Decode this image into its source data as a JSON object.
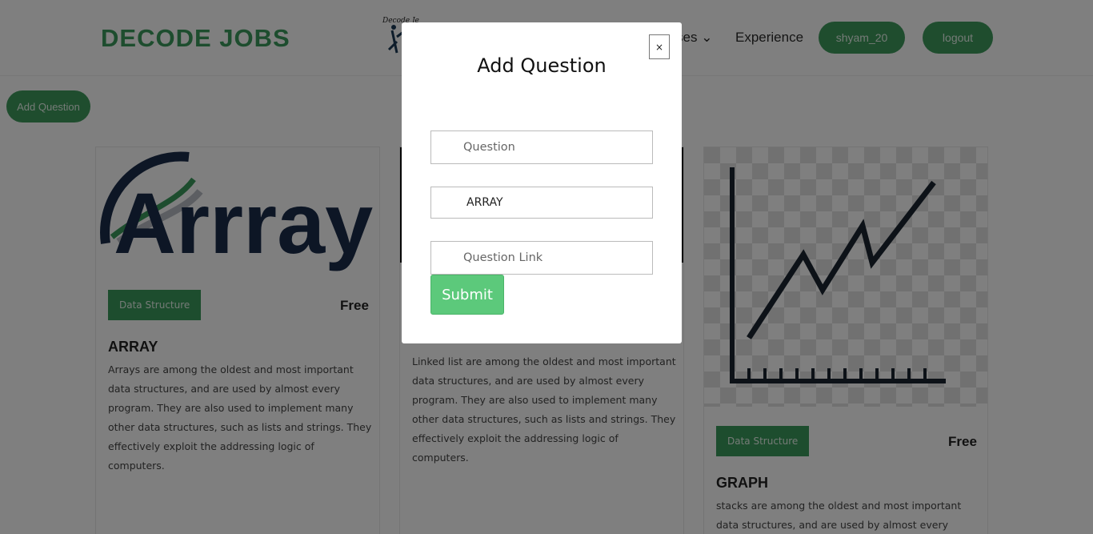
{
  "header": {
    "brand": "DECODE JOBS",
    "nav_courses": "ses",
    "nav_experience": "Experience",
    "username": "shyam_20",
    "logout": "logout"
  },
  "toolbar": {
    "add_question": "Add Question"
  },
  "cards": [
    {
      "image_text": "Arrray",
      "tag": "Data Structure",
      "price": "Free",
      "title": "ARRAY",
      "description": "Arrays are among the oldest and most important data structures, and are used by almost every program. They are also used to implement many other data structures, such as lists and strings. They effectively exploit the addressing logic of computers."
    },
    {
      "tag": "",
      "price": "",
      "title": "",
      "description": "Linked list are among the oldest and most important data structures, and are used by almost every program. They are also used to implement many other data structures, such as lists and strings. They effectively exploit the addressing logic of computers."
    },
    {
      "tag": "Data Structure",
      "price": "Free",
      "title": "GRAPH",
      "description": "stacks are among the oldest and most important data structures, and are used by almost every program."
    }
  ],
  "modal": {
    "title": "Add Question",
    "close": "×",
    "question_placeholder": "Question",
    "topic_value": "ARRAY",
    "link_placeholder": "Question Link",
    "submit": "Submit"
  },
  "colors": {
    "brand_green": "#3a9a5c",
    "submit_green": "#5cc97b",
    "overlay": "rgba(0,0,0,0.5)"
  }
}
